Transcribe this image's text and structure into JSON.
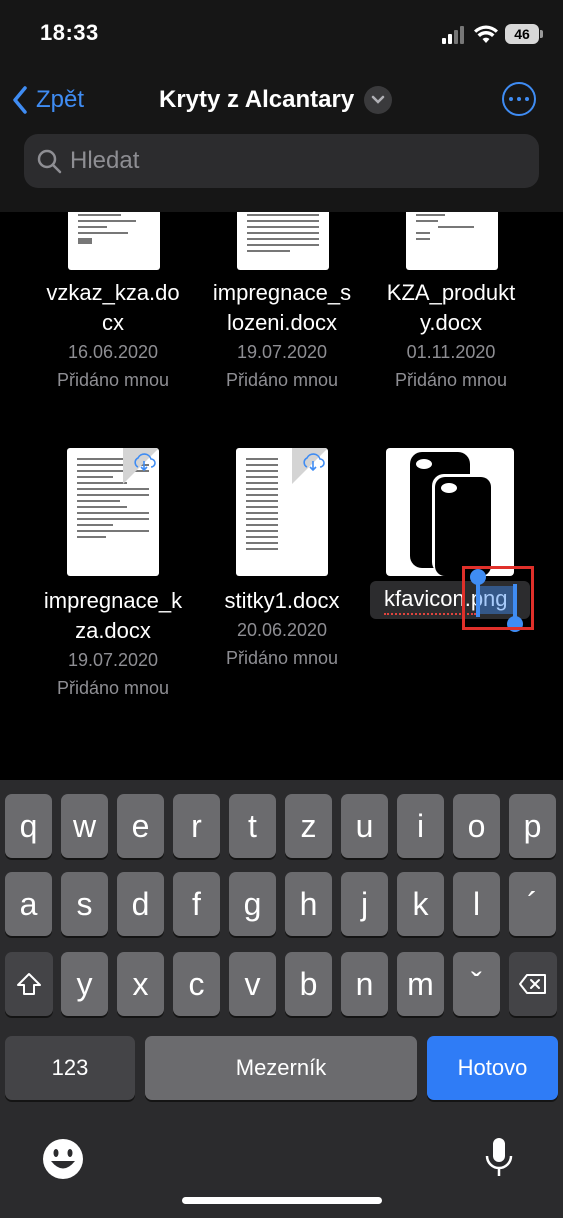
{
  "status": {
    "time": "18:33",
    "battery": "46"
  },
  "nav": {
    "back_label": "Zpět",
    "title": "Kryty z Alcantary"
  },
  "search": {
    "placeholder": "Hledat"
  },
  "files": [
    {
      "name_l1": "vzkaz_kza.do",
      "name_l2": "cx",
      "date": "16.06.2020",
      "owner": "Přidáno mnou"
    },
    {
      "name_l1": "impregnace_s",
      "name_l2": "lozeni.docx",
      "date": "19.07.2020",
      "owner": "Přidáno mnou"
    },
    {
      "name_l1": "KZA_produkt",
      "name_l2": "y.docx",
      "date": "01.11.2020",
      "owner": "Přidáno mnou"
    },
    {
      "name_l1": "impregnace_k",
      "name_l2": "za.docx",
      "date": "19.07.2020",
      "owner": "Přidáno mnou",
      "icon": "cloud-download-icon"
    },
    {
      "name_l1": "stitky1.docx",
      "date": "20.06.2020",
      "owner": "Přidáno mnou",
      "icon": "cloud-download-icon"
    },
    {
      "name_l1": "kfavicon.png",
      "editing": true,
      "selected_text": "png"
    }
  ],
  "keyboard": {
    "row1": [
      "q",
      "w",
      "e",
      "r",
      "t",
      "z",
      "u",
      "i",
      "o",
      "p"
    ],
    "row2": [
      "a",
      "s",
      "d",
      "f",
      "g",
      "h",
      "j",
      "k",
      "l",
      "´"
    ],
    "row3": [
      "y",
      "x",
      "c",
      "v",
      "b",
      "n",
      "m",
      "ˇ"
    ],
    "numbers_label": "123",
    "space_label": "Mezerník",
    "done_label": "Hotovo",
    "accent_color": "#2f7cf6"
  }
}
